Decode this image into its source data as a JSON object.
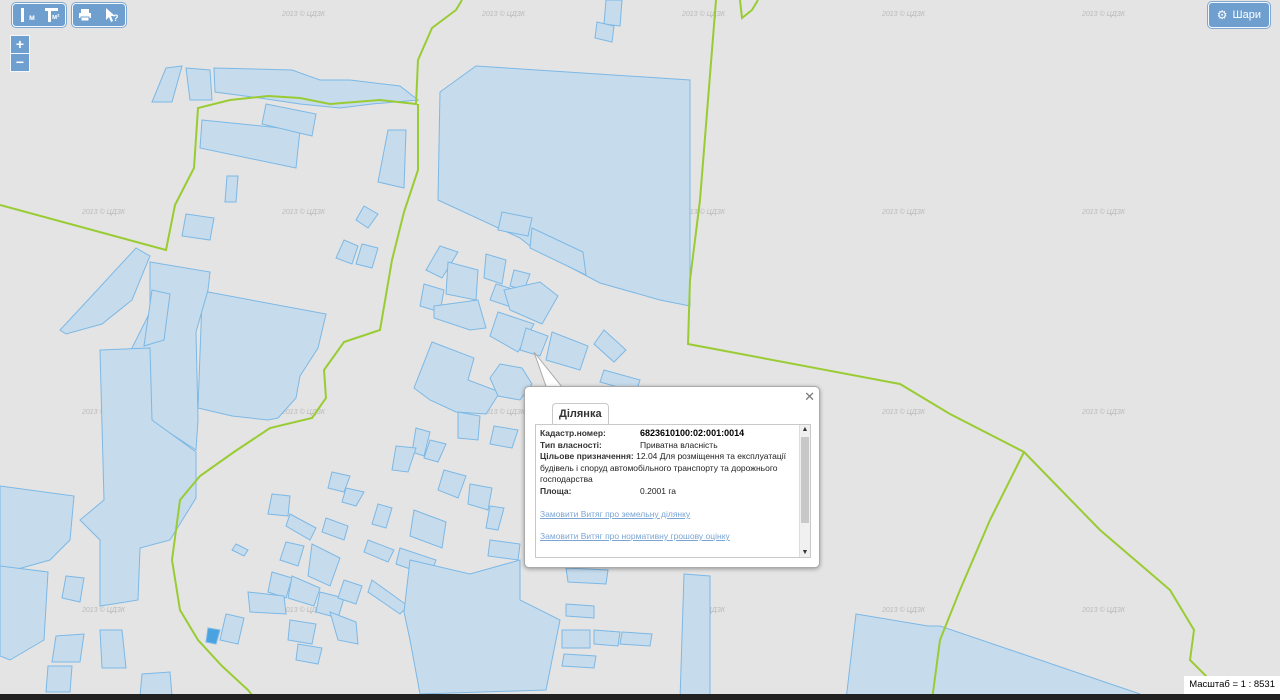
{
  "toolbar": {
    "measure_label": "м",
    "measure_area_label": "м²",
    "print_icon": "print-icon",
    "identify_label": "?"
  },
  "zoom": {
    "in_label": "+",
    "out_label": "−"
  },
  "layers_button": {
    "label": "Шари",
    "icon": "gear-icon"
  },
  "watermark": "2013 © ЦДЗК",
  "popup": {
    "tab_label": "Ділянка",
    "close_icon": "close-icon",
    "fields": [
      {
        "label": "Кадастр.номер:",
        "value": "6823610100:02:001:0014"
      },
      {
        "label": "Тип власності:",
        "value": "Приватна власність"
      },
      {
        "label": "Цільове призначення:",
        "value": "12.04 Для розміщення та експлуатації будівель і споруд автомобільного транспорту та дорожнього господарства"
      },
      {
        "label": "Площа:",
        "value": "0.2001 га"
      }
    ],
    "links": [
      "Замовити Витяг про земельну ділянку",
      "Замовити Витяг про нормативну грошову оцінку"
    ]
  },
  "scale": {
    "label": "Масштаб = 1 : 8531"
  },
  "colors": {
    "parcel_fill": "#c6dcec",
    "parcel_stroke": "#7cb8e6",
    "boundary": "#99cc33",
    "background": "#e4e4e4"
  }
}
